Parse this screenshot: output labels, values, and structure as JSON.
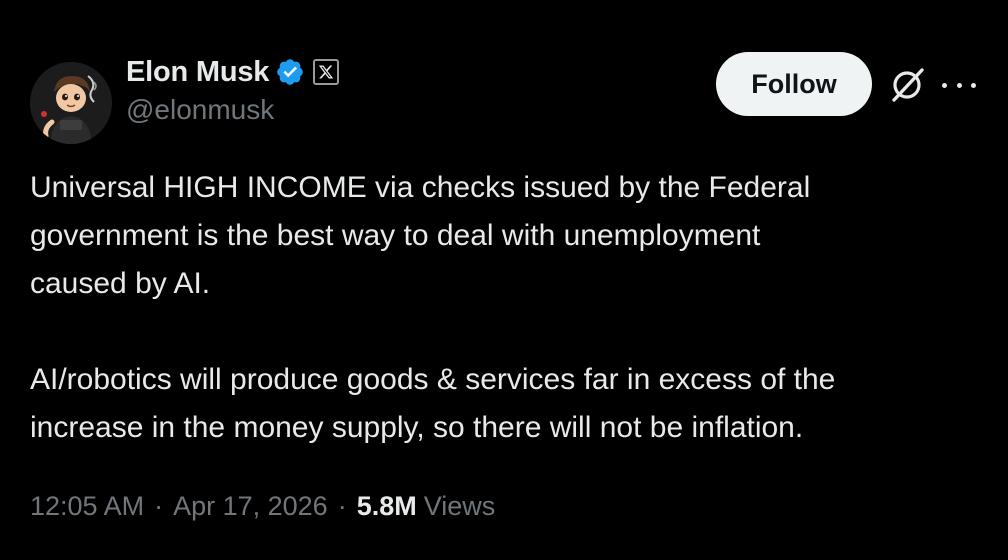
{
  "author": {
    "name": "Elon Musk",
    "handle": "@elonmusk",
    "avatar_icon": "cartoon-avatar",
    "verified_icon": "verified-badge-icon",
    "verified_color": "#1d9bf0",
    "affiliate_icon": "x-logo-icon"
  },
  "actions": {
    "follow_label": "Follow",
    "grok_icon": "grok-icon",
    "more_icon": "more-icon"
  },
  "tweet": {
    "paragraph_1": [
      "Universal HIGH INCOME via checks issued by the Federal",
      "government is the best way to deal with unemployment",
      "caused by AI."
    ],
    "paragraph_2": [
      "AI/robotics will produce goods & services far in excess of the",
      "increase in the money supply, so there will not be inflation."
    ]
  },
  "meta": {
    "time": "12:05 AM",
    "separator": "·",
    "date": "Apr 17, 2026",
    "views_count": "5.8M",
    "views_label": "Views"
  },
  "colors": {
    "background": "#000000",
    "text_primary": "#e7e9ea",
    "text_secondary": "#71767b",
    "follow_bg": "#eff3f4",
    "follow_text": "#0f1419"
  }
}
